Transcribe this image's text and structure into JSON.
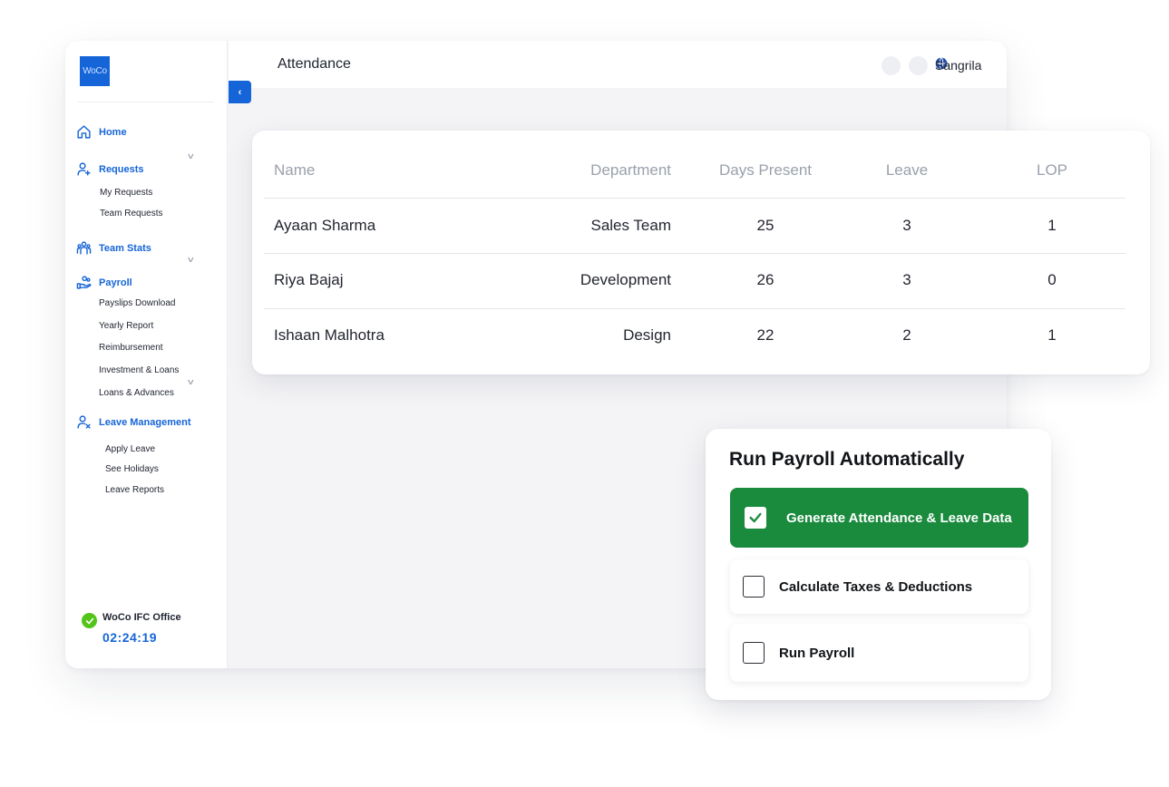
{
  "sidebar": {
    "logo": "WoCo",
    "nav": [
      {
        "label": "Home",
        "icon": "home-icon"
      },
      {
        "label": "Requests",
        "icon": "user-plus-icon",
        "children": [
          "My Requests",
          "Team Requests"
        ]
      },
      {
        "label": "Team Stats",
        "icon": "team-icon"
      },
      {
        "label": "Payroll",
        "icon": "payroll-hand-icon",
        "children": [
          "Payslips Download",
          "Yearly Report",
          "Reimbursement",
          "Investment & Loans",
          "Loans & Advances"
        ]
      },
      {
        "label": "Leave Management",
        "icon": "user-remove-icon",
        "children": [
          "Apply Leave",
          "See Holidays",
          "Leave Reports"
        ]
      }
    ],
    "office": {
      "name": "WoCo IFC Office",
      "timer": "02:24:19"
    }
  },
  "header": {
    "title": "Attendance",
    "user_name": "Sangrila"
  },
  "attendance": {
    "columns": [
      "Name",
      "Department",
      "Days Present",
      "Leave",
      "LOP"
    ],
    "rows": [
      [
        "Ayaan Sharma",
        "Sales Team",
        "25",
        "3",
        "1"
      ],
      [
        "Riya Bajaj",
        "Development",
        "26",
        "3",
        "0"
      ],
      [
        "Ishaan Malhotra",
        "Design",
        "22",
        "2",
        "1"
      ]
    ]
  },
  "payroll": {
    "title": "Run Payroll Automatically",
    "steps": [
      {
        "label": "Generate Attendance & Leave Data",
        "checked": true
      },
      {
        "label": "Calculate Taxes & Deductions",
        "checked": false
      },
      {
        "label": "Run Payroll",
        "checked": false
      }
    ]
  },
  "colors": {
    "primary": "#1565d8",
    "success": "#1a8a3d",
    "online": "#52c41a",
    "muted_header": "#9aa0ab"
  }
}
